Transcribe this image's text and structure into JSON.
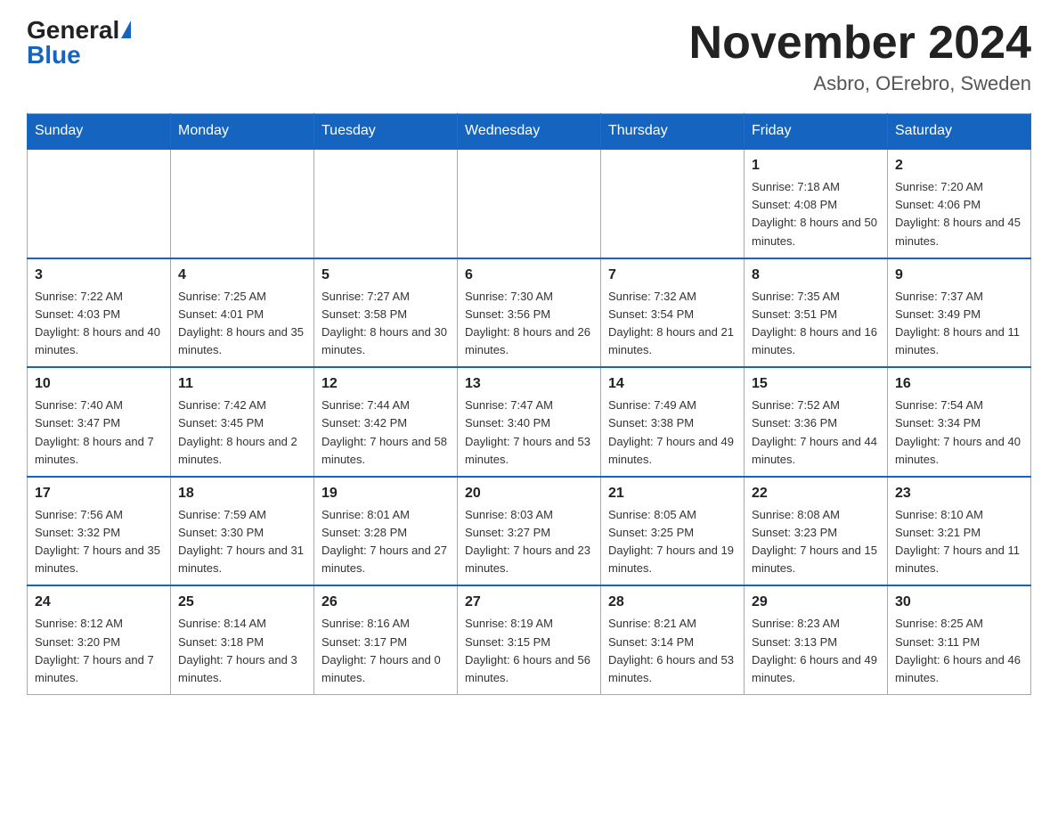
{
  "logo": {
    "general": "General",
    "blue": "Blue",
    "triangle": "▶"
  },
  "title": {
    "month_year": "November 2024",
    "location": "Asbro, OErebro, Sweden"
  },
  "days_of_week": [
    "Sunday",
    "Monday",
    "Tuesday",
    "Wednesday",
    "Thursday",
    "Friday",
    "Saturday"
  ],
  "weeks": [
    [
      {
        "day": "",
        "info": ""
      },
      {
        "day": "",
        "info": ""
      },
      {
        "day": "",
        "info": ""
      },
      {
        "day": "",
        "info": ""
      },
      {
        "day": "",
        "info": ""
      },
      {
        "day": "1",
        "info": "Sunrise: 7:18 AM\nSunset: 4:08 PM\nDaylight: 8 hours\nand 50 minutes."
      },
      {
        "day": "2",
        "info": "Sunrise: 7:20 AM\nSunset: 4:06 PM\nDaylight: 8 hours\nand 45 minutes."
      }
    ],
    [
      {
        "day": "3",
        "info": "Sunrise: 7:22 AM\nSunset: 4:03 PM\nDaylight: 8 hours\nand 40 minutes."
      },
      {
        "day": "4",
        "info": "Sunrise: 7:25 AM\nSunset: 4:01 PM\nDaylight: 8 hours\nand 35 minutes."
      },
      {
        "day": "5",
        "info": "Sunrise: 7:27 AM\nSunset: 3:58 PM\nDaylight: 8 hours\nand 30 minutes."
      },
      {
        "day": "6",
        "info": "Sunrise: 7:30 AM\nSunset: 3:56 PM\nDaylight: 8 hours\nand 26 minutes."
      },
      {
        "day": "7",
        "info": "Sunrise: 7:32 AM\nSunset: 3:54 PM\nDaylight: 8 hours\nand 21 minutes."
      },
      {
        "day": "8",
        "info": "Sunrise: 7:35 AM\nSunset: 3:51 PM\nDaylight: 8 hours\nand 16 minutes."
      },
      {
        "day": "9",
        "info": "Sunrise: 7:37 AM\nSunset: 3:49 PM\nDaylight: 8 hours\nand 11 minutes."
      }
    ],
    [
      {
        "day": "10",
        "info": "Sunrise: 7:40 AM\nSunset: 3:47 PM\nDaylight: 8 hours\nand 7 minutes."
      },
      {
        "day": "11",
        "info": "Sunrise: 7:42 AM\nSunset: 3:45 PM\nDaylight: 8 hours\nand 2 minutes."
      },
      {
        "day": "12",
        "info": "Sunrise: 7:44 AM\nSunset: 3:42 PM\nDaylight: 7 hours\nand 58 minutes."
      },
      {
        "day": "13",
        "info": "Sunrise: 7:47 AM\nSunset: 3:40 PM\nDaylight: 7 hours\nand 53 minutes."
      },
      {
        "day": "14",
        "info": "Sunrise: 7:49 AM\nSunset: 3:38 PM\nDaylight: 7 hours\nand 49 minutes."
      },
      {
        "day": "15",
        "info": "Sunrise: 7:52 AM\nSunset: 3:36 PM\nDaylight: 7 hours\nand 44 minutes."
      },
      {
        "day": "16",
        "info": "Sunrise: 7:54 AM\nSunset: 3:34 PM\nDaylight: 7 hours\nand 40 minutes."
      }
    ],
    [
      {
        "day": "17",
        "info": "Sunrise: 7:56 AM\nSunset: 3:32 PM\nDaylight: 7 hours\nand 35 minutes."
      },
      {
        "day": "18",
        "info": "Sunrise: 7:59 AM\nSunset: 3:30 PM\nDaylight: 7 hours\nand 31 minutes."
      },
      {
        "day": "19",
        "info": "Sunrise: 8:01 AM\nSunset: 3:28 PM\nDaylight: 7 hours\nand 27 minutes."
      },
      {
        "day": "20",
        "info": "Sunrise: 8:03 AM\nSunset: 3:27 PM\nDaylight: 7 hours\nand 23 minutes."
      },
      {
        "day": "21",
        "info": "Sunrise: 8:05 AM\nSunset: 3:25 PM\nDaylight: 7 hours\nand 19 minutes."
      },
      {
        "day": "22",
        "info": "Sunrise: 8:08 AM\nSunset: 3:23 PM\nDaylight: 7 hours\nand 15 minutes."
      },
      {
        "day": "23",
        "info": "Sunrise: 8:10 AM\nSunset: 3:21 PM\nDaylight: 7 hours\nand 11 minutes."
      }
    ],
    [
      {
        "day": "24",
        "info": "Sunrise: 8:12 AM\nSunset: 3:20 PM\nDaylight: 7 hours\nand 7 minutes."
      },
      {
        "day": "25",
        "info": "Sunrise: 8:14 AM\nSunset: 3:18 PM\nDaylight: 7 hours\nand 3 minutes."
      },
      {
        "day": "26",
        "info": "Sunrise: 8:16 AM\nSunset: 3:17 PM\nDaylight: 7 hours\nand 0 minutes."
      },
      {
        "day": "27",
        "info": "Sunrise: 8:19 AM\nSunset: 3:15 PM\nDaylight: 6 hours\nand 56 minutes."
      },
      {
        "day": "28",
        "info": "Sunrise: 8:21 AM\nSunset: 3:14 PM\nDaylight: 6 hours\nand 53 minutes."
      },
      {
        "day": "29",
        "info": "Sunrise: 8:23 AM\nSunset: 3:13 PM\nDaylight: 6 hours\nand 49 minutes."
      },
      {
        "day": "30",
        "info": "Sunrise: 8:25 AM\nSunset: 3:11 PM\nDaylight: 6 hours\nand 46 minutes."
      }
    ]
  ]
}
